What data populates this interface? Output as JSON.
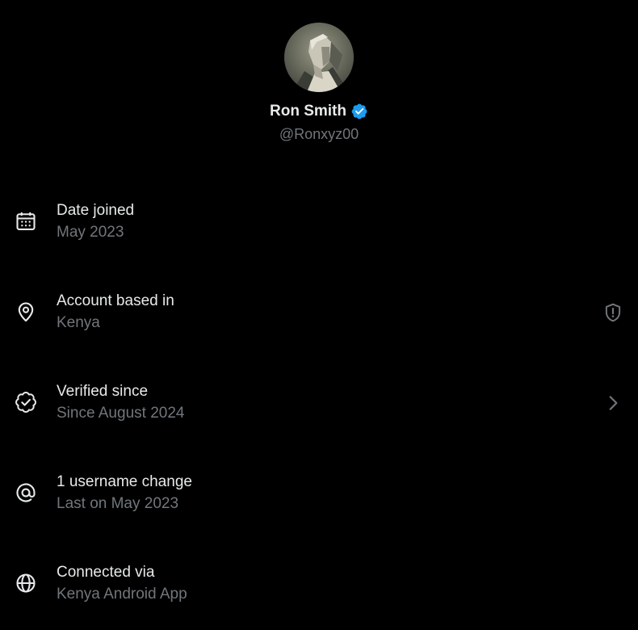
{
  "profile": {
    "name": "Ron Smith",
    "handle": "@Ronxyz00",
    "verified": true,
    "badge_color": "#1d9bf0"
  },
  "rows": [
    {
      "icon": "calendar-icon",
      "label": "Date joined",
      "value": "May 2023",
      "trailing": null
    },
    {
      "icon": "location-pin-icon",
      "label": "Account based in",
      "value": "Kenya",
      "trailing": "shield-alert-icon"
    },
    {
      "icon": "verified-check-icon",
      "label": "Verified since",
      "value": "Since August 2024",
      "trailing": "chevron-right-icon"
    },
    {
      "icon": "at-sign-icon",
      "label": "1 username change",
      "value": "Last on May 2023",
      "trailing": null
    },
    {
      "icon": "globe-icon",
      "label": "Connected via",
      "value": "Kenya Android App",
      "trailing": null
    }
  ],
  "colors": {
    "background": "#000000",
    "primary_text": "#e7e9ea",
    "secondary_text": "#71767b",
    "accent": "#1d9bf0"
  }
}
